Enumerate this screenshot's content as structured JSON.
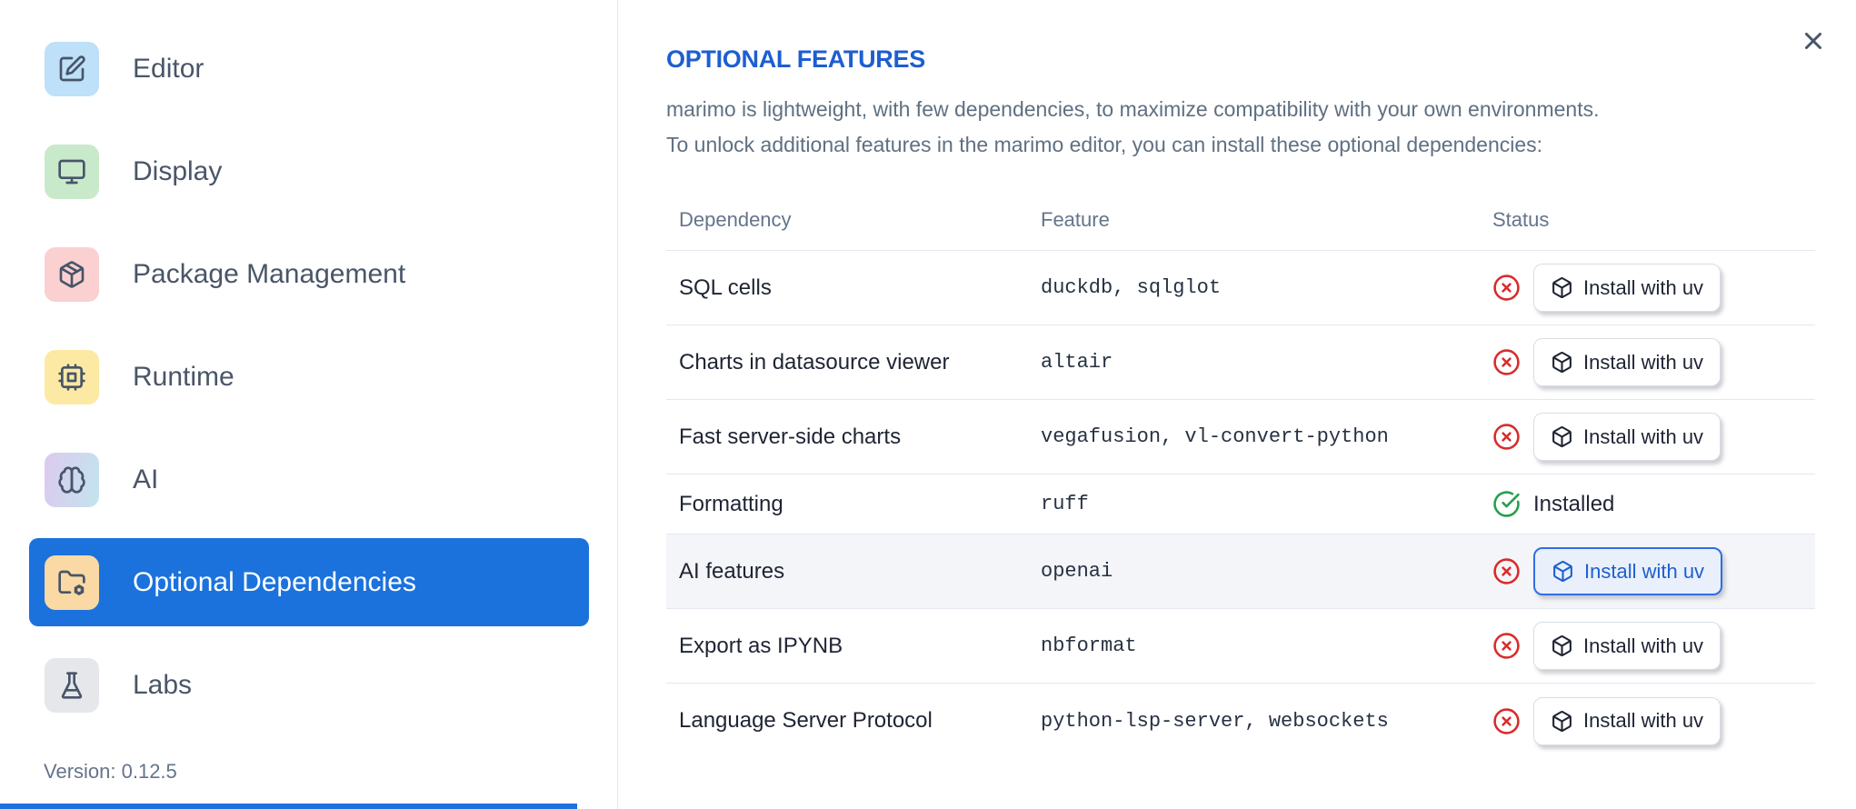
{
  "sidebar": {
    "items": [
      {
        "label": "Editor",
        "icon": "square-pen-icon",
        "icon_bg": "#bee0f8",
        "selected": false
      },
      {
        "label": "Display",
        "icon": "monitor-icon",
        "icon_bg": "#c9e9cb",
        "selected": false
      },
      {
        "label": "Package Management",
        "icon": "package-icon",
        "icon_bg": "#fbd0d0",
        "selected": false
      },
      {
        "label": "Runtime",
        "icon": "cpu-icon",
        "icon_bg": "#fce9a4",
        "selected": false
      },
      {
        "label": "AI",
        "icon": "brain-icon",
        "icon_bg": "linear-gradient(100deg, #dccaee, #c3e4ee)",
        "selected": false
      },
      {
        "label": "Optional Dependencies",
        "icon": "folder-cog-icon",
        "icon_bg": "#fbd9a4",
        "selected": true
      },
      {
        "label": "Labs",
        "icon": "flask-icon",
        "icon_bg": "#e5e7ea",
        "selected": false
      }
    ],
    "version_label": "Version: 0.12.5"
  },
  "main": {
    "title": "OPTIONAL FEATURES",
    "description_lines": [
      "marimo is lightweight, with few dependencies, to maximize compatibility with your own environments.",
      "To unlock additional features in the marimo editor, you can install these optional dependencies:"
    ],
    "table": {
      "columns": [
        "Dependency",
        "Feature",
        "Status"
      ],
      "install_button_label": "Install with uv",
      "installed_label": "Installed",
      "rows": [
        {
          "dependency": "SQL cells",
          "feature": "duckdb, sqlglot",
          "installed": false,
          "highlighted": false,
          "button_focused": false
        },
        {
          "dependency": "Charts in datasource viewer",
          "feature": "altair",
          "installed": false,
          "highlighted": false,
          "button_focused": false
        },
        {
          "dependency": "Fast server-side charts",
          "feature": "vegafusion, vl-convert-python",
          "installed": false,
          "highlighted": false,
          "button_focused": false
        },
        {
          "dependency": "Formatting",
          "feature": "ruff",
          "installed": true,
          "highlighted": false,
          "button_focused": false
        },
        {
          "dependency": "AI features",
          "feature": "openai",
          "installed": false,
          "highlighted": true,
          "button_focused": true
        },
        {
          "dependency": "Export as IPYNB",
          "feature": "nbformat",
          "installed": false,
          "highlighted": false,
          "button_focused": false
        },
        {
          "dependency": "Language Server Protocol",
          "feature": "python-lsp-server, websockets",
          "installed": false,
          "highlighted": false,
          "button_focused": false
        }
      ]
    }
  },
  "colors": {
    "primary_blue": "#1b72dd",
    "heading_blue": "#1d5ed1",
    "focus_button_blue": "#2e6fe3",
    "focus_button_bg": "#e9f0fb",
    "status_red": "#d92b2b",
    "status_green": "#23a14d",
    "row_highlight_bg": "#f4f5f8",
    "divider": "#e3e8ef",
    "text_dark": "#1e2433",
    "text_muted": "#64748b"
  }
}
